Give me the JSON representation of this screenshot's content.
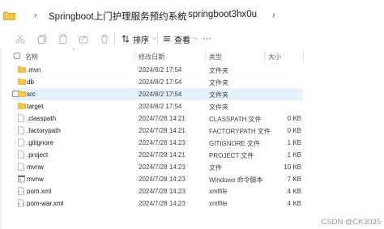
{
  "breadcrumb": {
    "items": [
      "Springboot上门护理服务预约系统",
      "springboot3hx0u"
    ]
  },
  "toolbar": {
    "sort_label": "排序",
    "view_label": "查看",
    "icons": [
      "cut-icon",
      "copy-icon",
      "paste-icon",
      "share-icon",
      "delete-icon"
    ]
  },
  "columns": {
    "name": "名称",
    "date": "修改日期",
    "type": "类型",
    "size": "大小"
  },
  "files": [
    {
      "name": ".mvn",
      "date": "2024/8/2 17:54",
      "type": "文件夹",
      "size": "",
      "icon": "folder-icon",
      "selected": false
    },
    {
      "name": "db",
      "date": "2024/8/2 17:54",
      "type": "文件夹",
      "size": "",
      "icon": "folder-icon",
      "selected": false
    },
    {
      "name": "src",
      "date": "2024/8/2 17:54",
      "type": "文件夹",
      "size": "",
      "icon": "folder-icon",
      "selected": true
    },
    {
      "name": "target",
      "date": "2024/8/2 17:54",
      "type": "文件夹",
      "size": "",
      "icon": "folder-icon",
      "selected": false
    },
    {
      "name": ".classpath",
      "date": "2024/7/28 14:21",
      "type": "CLASSPATH 文件",
      "size": "0 KB",
      "icon": "file-icon",
      "selected": false
    },
    {
      "name": ".factorypath",
      "date": "2024/7/28 14:21",
      "type": "FACTORYPATH 文件",
      "size": "0 KB",
      "icon": "file-icon",
      "selected": false
    },
    {
      "name": ".gitignore",
      "date": "2024/7/28 14:23",
      "type": "GITIGNORE 文件",
      "size": "1 KB",
      "icon": "file-icon",
      "selected": false
    },
    {
      "name": ".project",
      "date": "2024/7/28 14:21",
      "type": "PROJECT 文件",
      "size": "1 KB",
      "icon": "file-icon",
      "selected": false
    },
    {
      "name": "mvnw",
      "date": "2024/7/28 14:23",
      "type": "文件",
      "size": "10 KB",
      "icon": "file-icon",
      "selected": false
    },
    {
      "name": "mvnw",
      "date": "2024/7/28 14:23",
      "type": "Windows 命令脚本",
      "size": "7 KB",
      "icon": "script-icon",
      "selected": false
    },
    {
      "name": "pom.xml",
      "date": "2024/7/28 14:23",
      "type": "xmlfile",
      "size": "4 KB",
      "icon": "xml-file-icon",
      "selected": false
    },
    {
      "name": "pom-war.xml",
      "date": "2024/7/28 14:23",
      "type": "xmlfile",
      "size": "4 KB",
      "icon": "xml-file-icon",
      "selected": false
    }
  ],
  "watermark": "CSDN @CK3035",
  "colors": {
    "folder": "#e8b53a",
    "selected_row": "#e5f1fb"
  }
}
